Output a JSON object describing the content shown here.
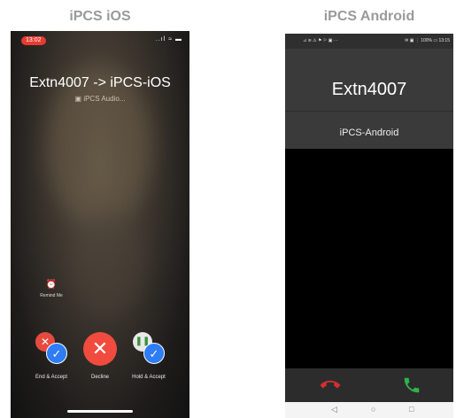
{
  "labels": {
    "ios": "iPCS iOS",
    "android": "iPCS Android"
  },
  "ios": {
    "status_time": "13:02",
    "status_icons": "..ıl ≈ ▬",
    "caller_title": "Extn4007 -> iPCS-iOS",
    "caller_subtitle": "iPCS Audio...",
    "remind_label": "Remind Me",
    "buttons": {
      "end_accept": "End & Accept",
      "decline": "Decline",
      "hold_accept": "Hold & Accept"
    },
    "colors": {
      "decline": "#f14b3f",
      "accept": "#2e7cf6"
    }
  },
  "android": {
    "status_left": "⊿ ≋ ⚠ ⚑ ⚐ ▣ ···",
    "status_right": "✉ ▣ ⋮ 100% ▭ 13:15",
    "caller_name": "Extn4007",
    "app_name": "iPCS-Android",
    "colors": {
      "reject": "#d32f2f",
      "answer": "#2fb34a"
    },
    "nav": {
      "back": "◁",
      "home": "○",
      "recent": "□"
    }
  }
}
